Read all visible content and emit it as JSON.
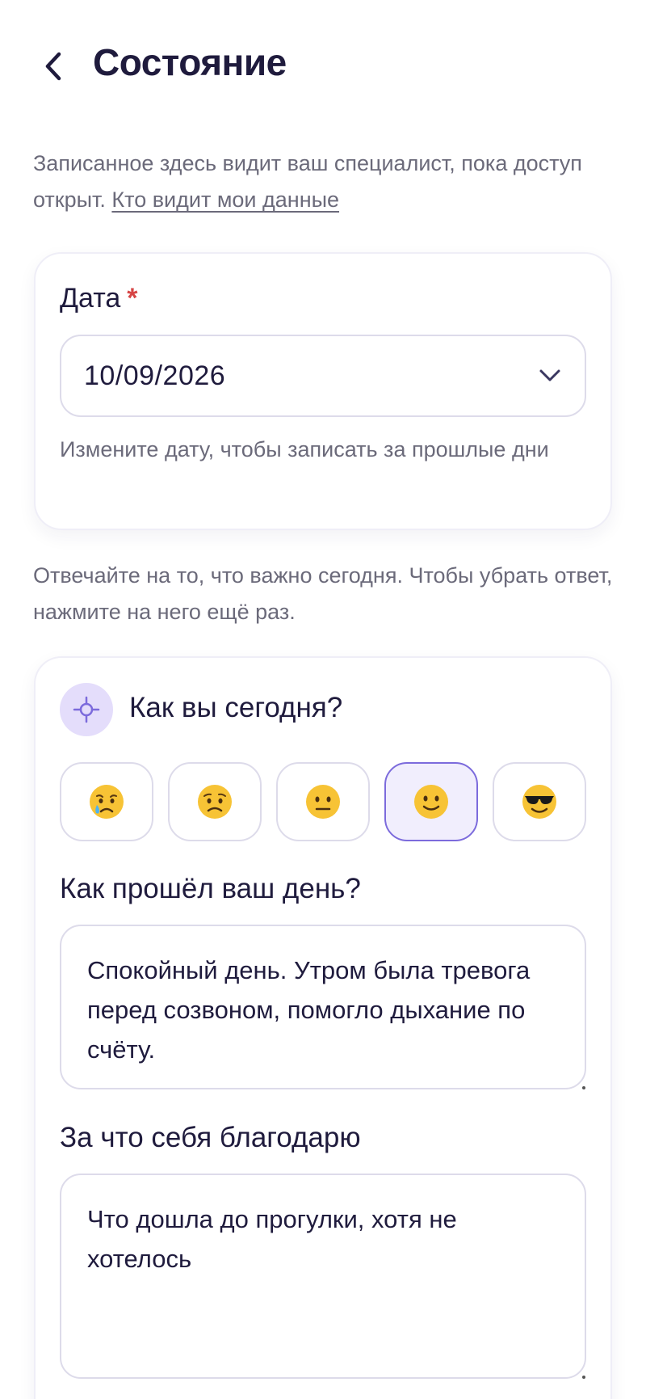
{
  "header": {
    "title": "Состояние"
  },
  "intro": {
    "text": "Записанное здесь видит ваш специалист, пока доступ открыт. ",
    "link": "Кто видит мои данные"
  },
  "date_card": {
    "label": "Дата",
    "required_mark": "*",
    "value": "10/09/2026",
    "help": "Измените дату, чтобы записать за прошлые дни"
  },
  "instructions": "Отвечайте на то, что важно сегодня. Чтобы убрать ответ, нажмите на него ещё раз.",
  "mood": {
    "question": "Как вы сегодня?",
    "options": [
      {
        "name": "crying-face-icon"
      },
      {
        "name": "worried-face-icon"
      },
      {
        "name": "neutral-face-icon"
      },
      {
        "name": "slightly-smiling-face-icon",
        "selected": true
      },
      {
        "name": "sunglasses-face-icon"
      }
    ],
    "selected_index": 3
  },
  "day_question": {
    "title": "Как прошёл ваш день?",
    "value": "Спокойный день. Утром была тревога перед созвоном, помогло дыхание по счёту."
  },
  "gratitude": {
    "title": "За что себя благодарю",
    "value": "Что дошла до прогулки, хотя не хотелось"
  },
  "colors": {
    "accent": "#7c6bdc",
    "selected_bg": "#f1eefd",
    "icon_bg": "#e4ddfb",
    "required": "#d64545",
    "text_primary": "#1f1b3d",
    "text_secondary": "#6b6a7a"
  }
}
